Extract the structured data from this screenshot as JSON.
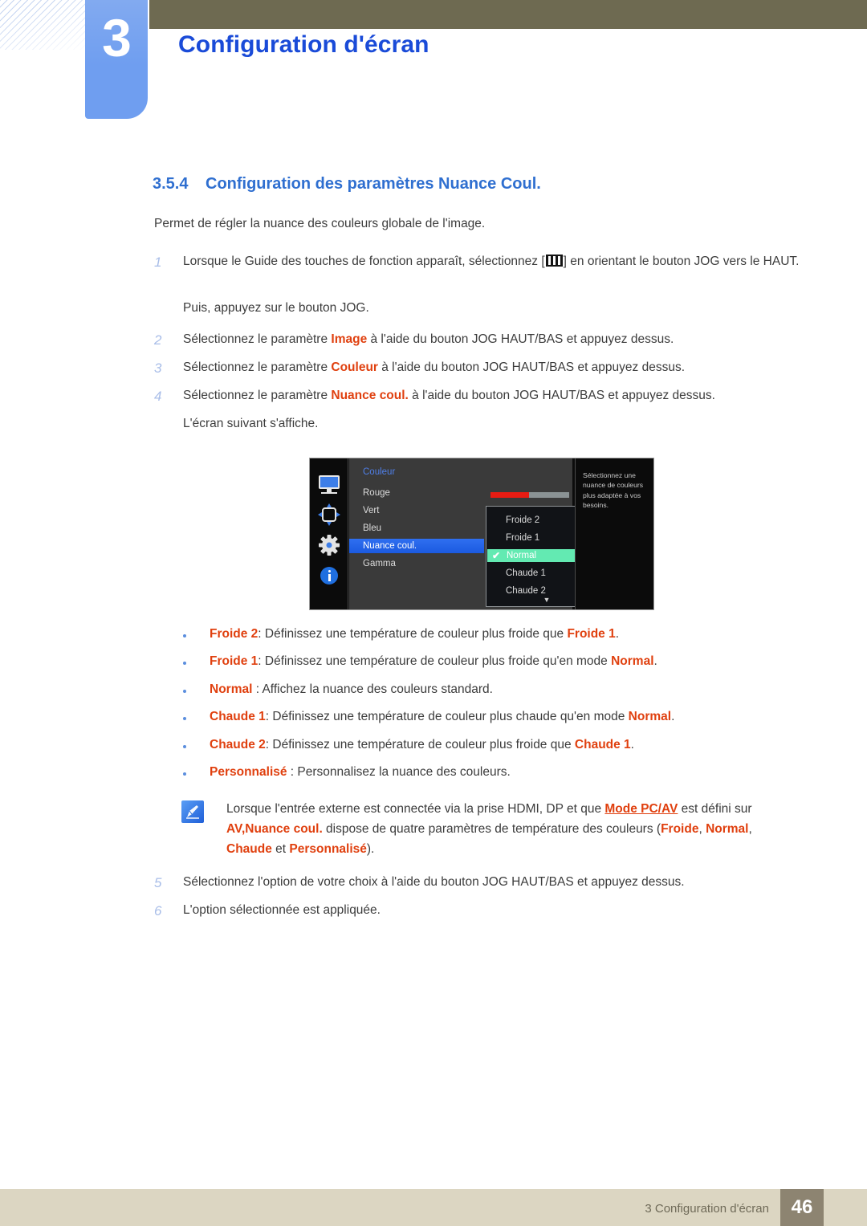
{
  "header": {
    "chapter_number": "3",
    "chapter_title": "Configuration d'écran"
  },
  "section": {
    "number": "3.5.4",
    "title": "Configuration des paramètres Nuance Coul.",
    "intro": "Permet de régler la nuance des couleurs globale de l'image."
  },
  "steps": {
    "s1_num": "1",
    "s1_a": "Lorsque le Guide des touches de fonction apparaît, sélectionnez [",
    "s1_b": "] en orientant le bouton JOG vers le HAUT.",
    "s1_extra": "Puis, appuyez sur le bouton JOG.",
    "s2_num": "2",
    "s2_a": "Sélectionnez le paramètre ",
    "s2_kw": "Image",
    "s2_b": " à l'aide du bouton JOG HAUT/BAS et appuyez dessus.",
    "s3_num": "3",
    "s3_a": "Sélectionnez le paramètre ",
    "s3_kw": "Couleur",
    "s3_b": " à l'aide du bouton JOG HAUT/BAS et appuyez dessus.",
    "s4_num": "4",
    "s4_a": "Sélectionnez le paramètre ",
    "s4_kw": "Nuance coul.",
    "s4_b": " à l'aide du bouton JOG HAUT/BAS et appuyez dessus.",
    "s4_extra": "L'écran suivant s'affiche.",
    "s5_num": "5",
    "s5_text": "Sélectionnez l'option de votre choix à l'aide du bouton JOG HAUT/BAS et appuyez dessus.",
    "s6_num": "6",
    "s6_text": "L'option sélectionnée est appliquée."
  },
  "osd": {
    "menu_title": "Couleur",
    "items": [
      {
        "label": "Rouge"
      },
      {
        "label": "Vert"
      },
      {
        "label": "Bleu"
      },
      {
        "label": "Nuance coul."
      },
      {
        "label": "Gamma"
      }
    ],
    "slider_value": "50",
    "slider_percent": 49,
    "dropdown": [
      {
        "label": "Froide 2"
      },
      {
        "label": "Froide 1"
      },
      {
        "label": "Normal"
      },
      {
        "label": "Chaude 1"
      },
      {
        "label": "Chaude 2"
      }
    ],
    "dropdown_check": "✔",
    "dropdown_more": "▼",
    "description": "Sélectionnez une nuance de couleurs plus adaptée à vos besoins.",
    "sidebar_icons": [
      "monitor-icon",
      "navigate-icon",
      "gear-icon",
      "info-icon"
    ],
    "colors": {
      "selected_item": "#1b5ae0",
      "dropdown_active": "#63eab2",
      "slider_fill": "#e81c13",
      "title": "#4f7fe8"
    }
  },
  "bullets": {
    "b1_kw": "Froide 2",
    "b1_mid": ": Définissez une température de couleur plus froide que ",
    "b1_kw2": "Froide 1",
    "b1_end": ".",
    "b2_kw": "Froide 1",
    "b2_mid": ": Définissez une température de couleur plus froide qu'en mode ",
    "b2_kw2": "Normal",
    "b2_end": ".",
    "b3_kw": "Normal",
    "b3_mid": " : Affichez la nuance des couleurs standard.",
    "b4_kw": "Chaude 1",
    "b4_mid": ": Définissez une température de couleur plus chaude qu'en mode ",
    "b4_kw2": "Normal",
    "b4_end": ".",
    "b5_kw": "Chaude 2",
    "b5_mid": ": Définissez une température de couleur plus froide que ",
    "b5_kw2": "Chaude 1",
    "b5_end": ".",
    "b6_kw": "Personnalisé",
    "b6_mid": " : Personnalisez la nuance des couleurs."
  },
  "note": {
    "a": "Lorsque l'entrée externe est connectée via la prise HDMI, DP et que ",
    "kw1": "Mode PC/AV",
    "b": " est défini sur ",
    "kw2": "AV",
    "c": ",",
    "kw3": "Nuance coul.",
    "d": " dispose de quatre paramètres de température des couleurs (",
    "kw4": "Froide",
    "e": ", ",
    "kw5": "Normal",
    "f": ", ",
    "kw6": "Chaude",
    "g": " et ",
    "kw7": "Personnalisé",
    "h": ")."
  },
  "footer": {
    "text": "3 Configuration d'écran",
    "page": "46"
  }
}
